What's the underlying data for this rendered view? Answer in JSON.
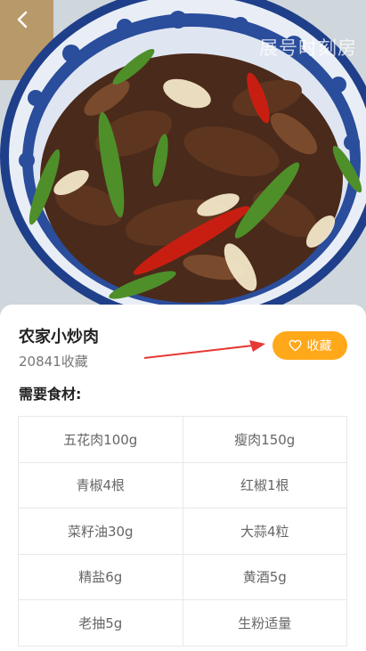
{
  "recipe": {
    "title": "农家小炒肉",
    "fav_count": "20841收藏",
    "fav_button_label": "收藏"
  },
  "watermark": "展号时刻房",
  "ingredients": {
    "heading": "需要食材:",
    "rows": [
      [
        "五花肉100g",
        "瘦肉150g"
      ],
      [
        "青椒4根",
        "红椒1根"
      ],
      [
        "菜籽油30g",
        "大蒜4粒"
      ],
      [
        "精盐6g",
        "黄酒5g"
      ],
      [
        "老抽5g",
        "生粉适量"
      ]
    ]
  },
  "icons": {
    "back": "chevron-left-icon",
    "favorite": "heart-outline-icon"
  },
  "colors": {
    "accent": "#ffa81a",
    "annotation_arrow": "#e53935"
  }
}
